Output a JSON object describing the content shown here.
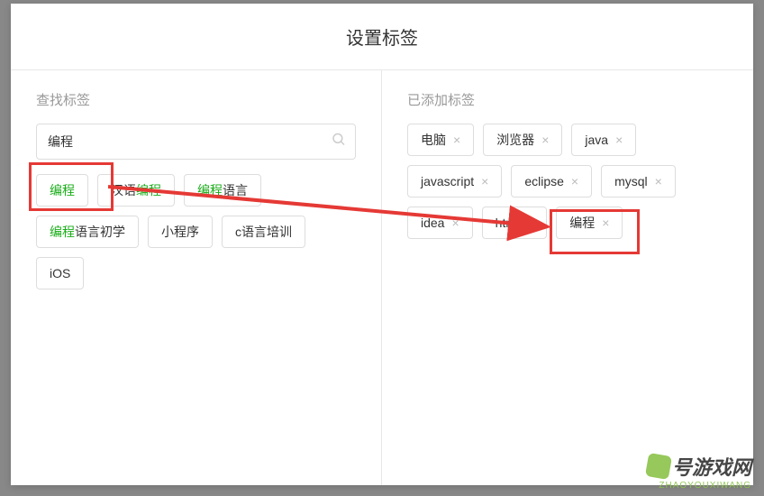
{
  "header": {
    "title": "设置标签"
  },
  "left": {
    "label": "查找标签",
    "search_value": "编程",
    "suggestions": [
      {
        "pre": "",
        "match": "编程",
        "post": ""
      },
      {
        "pre": "汉语",
        "match": "编程",
        "post": ""
      },
      {
        "pre": "",
        "match": "编程",
        "post": "语言"
      },
      {
        "pre": "",
        "match": "编程",
        "post": "语言初学"
      },
      {
        "pre": "小程序",
        "match": "",
        "post": ""
      },
      {
        "pre": "c语言培训",
        "match": "",
        "post": ""
      },
      {
        "pre": "iOS",
        "match": "",
        "post": ""
      }
    ]
  },
  "right": {
    "label": "已添加标签",
    "tags": [
      "电脑",
      "浏览器",
      "java",
      "javascript",
      "eclipse",
      "mysql",
      "idea",
      "html",
      "编程"
    ]
  },
  "icons": {
    "remove": "×"
  },
  "watermark": {
    "main": "号游戏网",
    "sub": "ZHAOYOUXIWANG"
  }
}
